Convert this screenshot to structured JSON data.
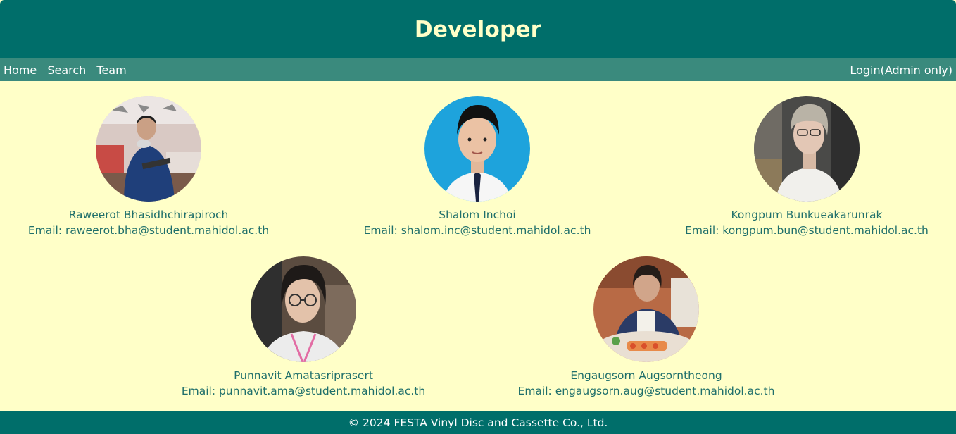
{
  "header": {
    "title": "Developer"
  },
  "nav": {
    "left": [
      {
        "label": "Home"
      },
      {
        "label": "Search"
      },
      {
        "label": "Team"
      }
    ],
    "right": {
      "label": "Login(Admin only)"
    }
  },
  "team": [
    {
      "name": "Raweerot Bhasidhchirapiroch",
      "email": "Email: raweerot.bha@student.mahidol.ac.th"
    },
    {
      "name": "Shalom Inchoi",
      "email": "Email: shalom.inc@student.mahidol.ac.th"
    },
    {
      "name": "Kongpum Bunkueakarunrak",
      "email": "Email: kongpum.bun@student.mahidol.ac.th"
    },
    {
      "name": "Punnavit Amatasriprasert",
      "email": "Email: punnavit.ama@student.mahidol.ac.th"
    },
    {
      "name": "Engaugsorn Augsorntheong",
      "email": "Email: engaugsorn.aug@student.mahidol.ac.th"
    }
  ],
  "footer": {
    "text": "© 2024 FESTA Vinyl Disc and Cassette Co., Ltd."
  }
}
